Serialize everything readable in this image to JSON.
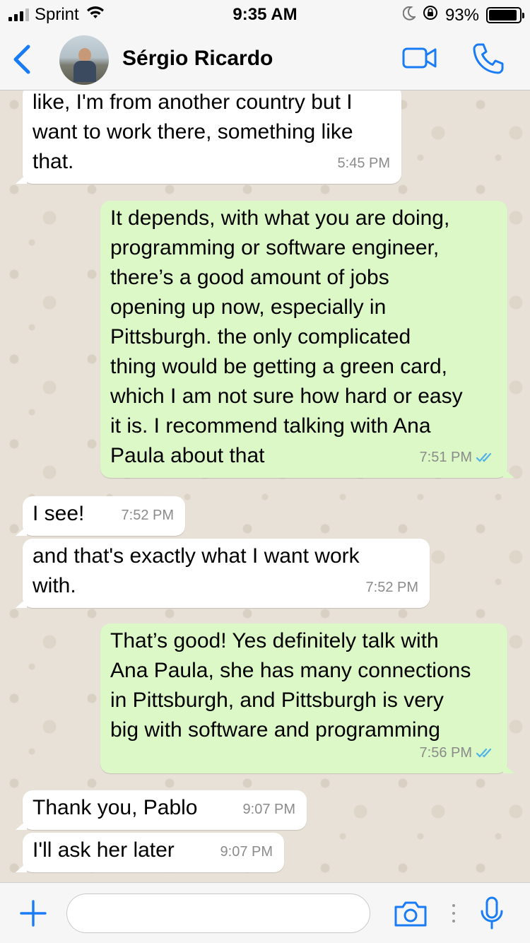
{
  "status": {
    "carrier": "Sprint",
    "time": "9:35 AM",
    "battery": "93%",
    "battery_level": 0.93
  },
  "header": {
    "contact_name": "Sérgio Ricardo",
    "icons": [
      "back-chevron-icon",
      "avatar",
      "video-call-icon",
      "phone-call-icon"
    ]
  },
  "messages": [
    {
      "direction": "in",
      "text": "like, I'm from another country but I\nwant to work there, something like\nthat.",
      "time": "5:45 PM"
    },
    {
      "direction": "out",
      "text": "It depends, with what you are doing,\nprogramming or software engineer,\nthere’s a good amount of jobs\nopening up now, especially in\nPittsburgh. the only complicated\nthing would be getting a green card,\nwhich I am not sure how hard or easy\nit is. I recommend talking with Ana\nPaula about that",
      "time": "7:51 PM",
      "read": true
    },
    {
      "direction": "in",
      "text": "I see!",
      "time": "7:52 PM"
    },
    {
      "direction": "in",
      "text": "and that's exactly what I want work\nwith.",
      "time": "7:52 PM"
    },
    {
      "direction": "out",
      "text": "That’s good! Yes definitely talk with\nAna Paula, she has many connections\nin Pittsburgh, and Pittsburgh is very\nbig with software and programming",
      "time": "7:56 PM",
      "read": true
    },
    {
      "direction": "in",
      "text": "Thank you, Pablo",
      "time": "9:07 PM"
    },
    {
      "direction": "in",
      "text": "I'll ask her later",
      "time": "9:07 PM"
    }
  ],
  "input": {
    "value": "",
    "placeholder": ""
  },
  "colors": {
    "accent": "#1a7cf5",
    "outgoing_bubble": "#dcf8c6",
    "incoming_bubble": "#ffffff",
    "read_ticks": "#4fb2e8"
  }
}
